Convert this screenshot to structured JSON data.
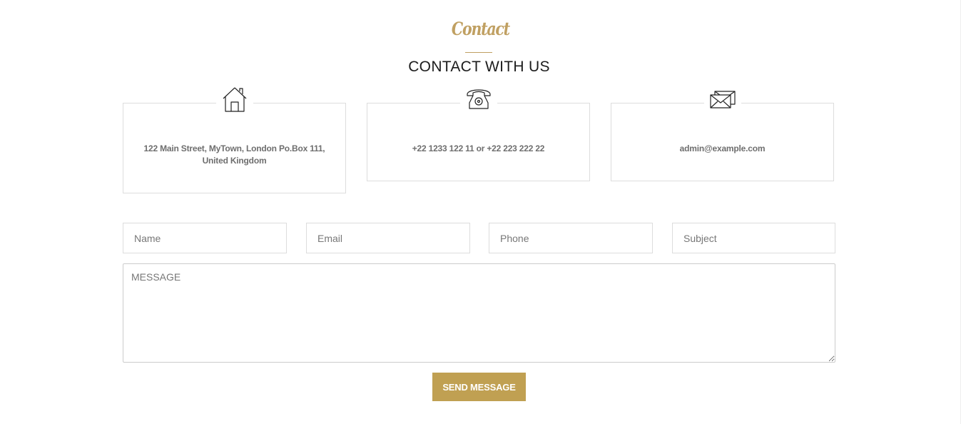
{
  "section": {
    "script_title": "Contact",
    "heading": "CONTACT WITH US",
    "accent_color": "#c0a062"
  },
  "contact_info": {
    "address": {
      "icon": "house-icon",
      "text": "122 Main Street, MyTown, London Po.Box 111, United Kingdom"
    },
    "phone": {
      "icon": "telephone-icon",
      "text": "+22 1233 122 11 or +22 223 222 22"
    },
    "email": {
      "icon": "envelope-icon",
      "text": "admin@example.com"
    }
  },
  "form": {
    "name_placeholder": "Name",
    "email_placeholder": "Email",
    "phone_placeholder": "Phone",
    "subject_placeholder": "Subject",
    "message_placeholder": "MESSAGE",
    "submit_label": "SEND MESSAGE",
    "button_color": "#c0a052"
  }
}
